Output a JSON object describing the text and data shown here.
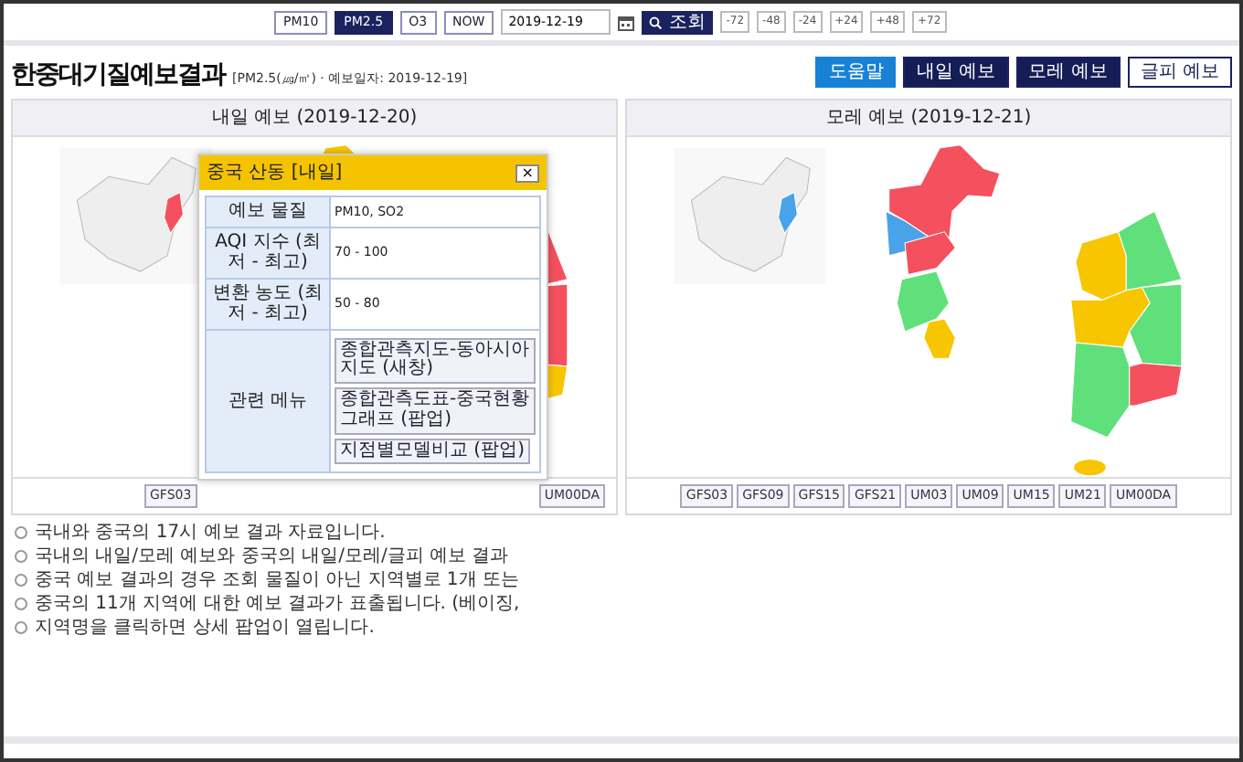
{
  "toolbar": {
    "pollutants": [
      {
        "label": "PM10",
        "selected": false
      },
      {
        "label": "PM2.5",
        "selected": true
      },
      {
        "label": "O3",
        "selected": false
      }
    ],
    "now_button": "NOW",
    "date": "2019-12-19",
    "search_button": "조회",
    "offsets": [
      "-72",
      "-48",
      "-24",
      "+24",
      "+48",
      "+72"
    ]
  },
  "title": "한중대기질예보결과",
  "subtitle": "[PM2.5(㎍/㎥) · 예보일자: 2019-12-19]",
  "action_buttons": [
    {
      "label": "도움말",
      "kind": "help"
    },
    {
      "label": "내일 예보",
      "kind": "dark"
    },
    {
      "label": "모레 예보",
      "kind": "dark"
    },
    {
      "label": "글피 예보",
      "kind": "outline"
    }
  ],
  "panels": [
    {
      "title": "내일 예보 (2019-12-20)",
      "map": {
        "kind": "picture"
      },
      "models": [
        "GFS03",
        "UM00DA"
      ]
    },
    {
      "title": "모레 예보 (2019-12-21)",
      "map": {
        "kind": "picture"
      },
      "models": [
        "GFS03",
        "GFS09",
        "GFS15",
        "GFS21",
        "UM03",
        "UM09",
        "UM15",
        "UM21",
        "UM00DA"
      ]
    }
  ],
  "popup": {
    "title": "중국 산동 [내일]",
    "close": "×",
    "rows": [
      {
        "kind": "text",
        "label": "예보 물질",
        "value": "PM10, SO2"
      },
      {
        "kind": "text",
        "label": "AQI 지수 (최저 - 최고)",
        "value": "70 - 100"
      },
      {
        "kind": "text",
        "label": "변환 농도 (최저 - 최고)",
        "value": "50 - 80"
      },
      {
        "kind": "links",
        "label": "관련 메뉴",
        "links": [
          "종합관측지도-동아시아지도 (새창)",
          "종합관측도표-중국현황 그래프 (팝업)",
          "지점별모델비교 (팝업)"
        ]
      }
    ]
  },
  "notes": [
    "국내와 중국의 17시 예보 결과 자료입니다.",
    "국내의 내일/모레 예보와 중국의 내일/모레/글피 예보 결과",
    "중국 예보 결과의 경우 조회 물질이 아닌 지역별로 1개 또는",
    "중국의 11개 지역에 대한 예보 결과가 표출됩니다. (베이징,",
    "지역명을 클릭하면 상세 팝업이 열립니다."
  ]
}
